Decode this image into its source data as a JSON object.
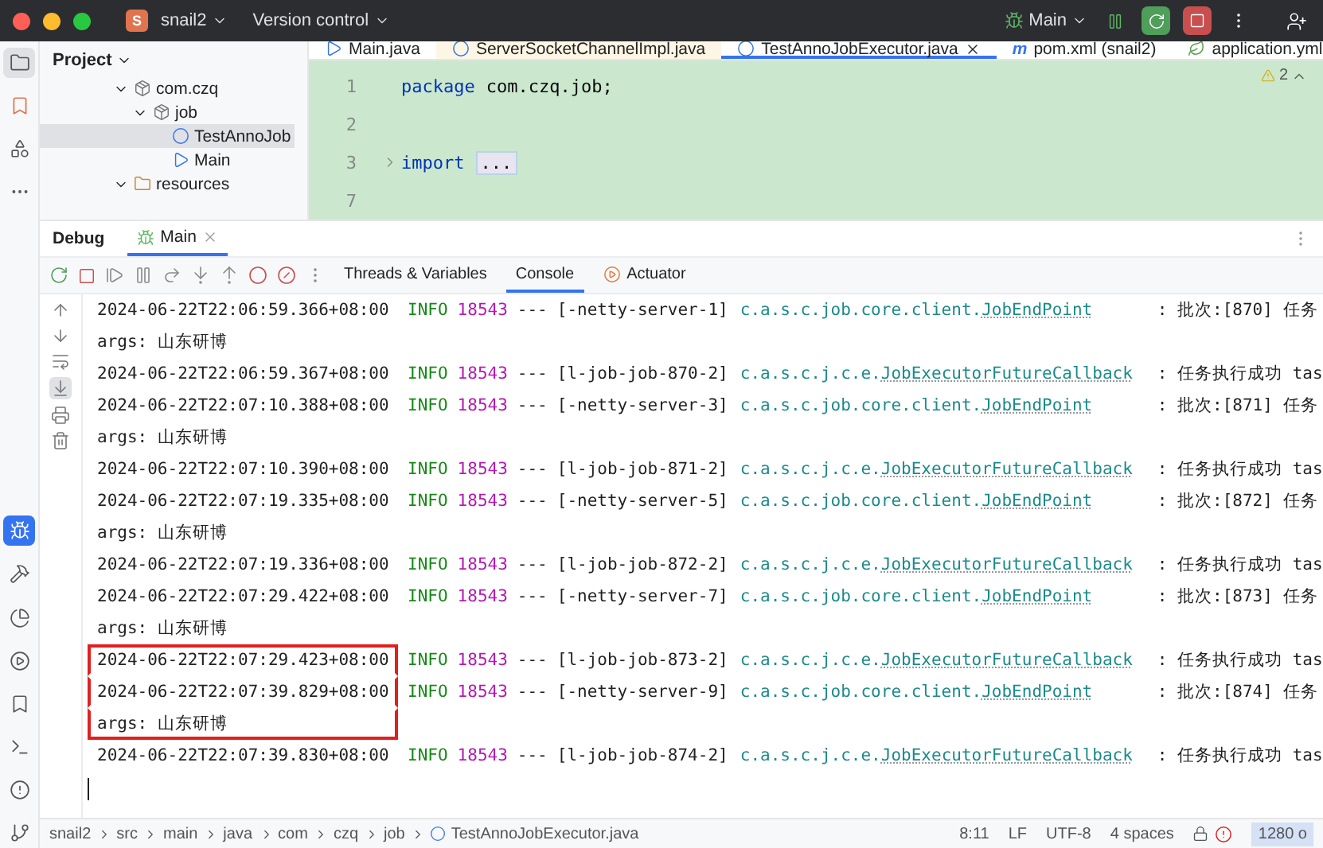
{
  "titlebar": {
    "project_badge": "S",
    "project": "snail2",
    "vcs": "Version control",
    "run_config": "Main"
  },
  "project_panel": {
    "title": "Project",
    "tree": [
      {
        "label": "com.czq",
        "kind": "package",
        "expanded": true,
        "selected": false,
        "children": [
          {
            "label": "job",
            "kind": "package",
            "expanded": true,
            "selected": false,
            "children": [
              {
                "label": "TestAnnoJob",
                "kind": "class",
                "selected": true
              },
              {
                "label": "Main",
                "kind": "main",
                "selected": false
              }
            ]
          }
        ]
      },
      {
        "label": "resources",
        "kind": "resources",
        "expanded": true,
        "selected": false
      }
    ]
  },
  "editor_tabs": [
    {
      "label": "Main.java",
      "kind": "main",
      "selected": false,
      "readonly": false
    },
    {
      "label": "ServerSocketChannelImpl.java",
      "kind": "class",
      "selected": false,
      "readonly": true
    },
    {
      "label": "TestAnnoJobExecutor.java",
      "kind": "class",
      "selected": true,
      "readonly": false
    },
    {
      "label": "pom.xml (snail2)",
      "kind": "maven",
      "icon": "m",
      "selected": false,
      "readonly": false
    },
    {
      "label": "application.yml",
      "kind": "yaml",
      "selected": false,
      "readonly": false
    }
  ],
  "editor": {
    "warnings": "2",
    "lines": [
      {
        "number": "1",
        "keyword": "package",
        "code": "com.czq.job;",
        "foldable": false
      },
      {
        "number": "2",
        "foldable": false
      },
      {
        "number": "3",
        "keyword": "import",
        "folded": "...",
        "foldable": true
      },
      {
        "number": "7",
        "foldable": false
      }
    ]
  },
  "debug_panel": {
    "title": "Debug",
    "session_tab": "Main",
    "tabs": [
      {
        "label": "Threads & Variables",
        "selected": false
      },
      {
        "label": "Console",
        "selected": true
      },
      {
        "label": "Actuator",
        "selected": false
      }
    ]
  },
  "console": [
    {
      "time": "2024-06-22T22:06:59.366+08:00",
      "level": "INFO",
      "pid": "18543",
      "sep": "---",
      "thread": "[-netty-server-1]",
      "logger": "c.a.s.c.job.core.client.",
      "logger_class": "JobEndPoint",
      "message": ": 批次:[870] 任务",
      "highlighted": false
    },
    {
      "text": "args: 山东研博",
      "highlighted": false
    },
    {
      "time": "2024-06-22T22:06:59.367+08:00",
      "level": "INFO",
      "pid": "18543",
      "sep": "---",
      "thread": "[l-job-job-870-2]",
      "logger": "c.a.s.c.j.c.e.",
      "logger_class": "JobExecutorFutureCallback",
      "message": ": 任务执行成功 tas",
      "highlighted": false
    },
    {
      "time": "2024-06-22T22:07:10.388+08:00",
      "level": "INFO",
      "pid": "18543",
      "sep": "---",
      "thread": "[-netty-server-3]",
      "logger": "c.a.s.c.job.core.client.",
      "logger_class": "JobEndPoint",
      "message": ": 批次:[871] 任务",
      "highlighted": false
    },
    {
      "text": "args: 山东研博",
      "highlighted": false
    },
    {
      "time": "2024-06-22T22:07:10.390+08:00",
      "level": "INFO",
      "pid": "18543",
      "sep": "---",
      "thread": "[l-job-job-871-2]",
      "logger": "c.a.s.c.j.c.e.",
      "logger_class": "JobExecutorFutureCallback",
      "message": ": 任务执行成功 tas",
      "highlighted": false
    },
    {
      "time": "2024-06-22T22:07:19.335+08:00",
      "level": "INFO",
      "pid": "18543",
      "sep": "---",
      "thread": "[-netty-server-5]",
      "logger": "c.a.s.c.job.core.client.",
      "logger_class": "JobEndPoint",
      "message": ": 批次:[872] 任务",
      "highlighted": false
    },
    {
      "text": "args: 山东研博",
      "highlighted": false
    },
    {
      "time": "2024-06-22T22:07:19.336+08:00",
      "level": "INFO",
      "pid": "18543",
      "sep": "---",
      "thread": "[l-job-job-872-2]",
      "logger": "c.a.s.c.j.c.e.",
      "logger_class": "JobExecutorFutureCallback",
      "message": ": 任务执行成功 tas",
      "highlighted": false
    },
    {
      "time": "2024-06-22T22:07:29.422+08:00",
      "level": "INFO",
      "pid": "18543",
      "sep": "---",
      "thread": "[-netty-server-7]",
      "logger": "c.a.s.c.job.core.client.",
      "logger_class": "JobEndPoint",
      "message": ": 批次:[873] 任务",
      "highlighted": false
    },
    {
      "text": "args: 山东研博",
      "highlighted": false
    },
    {
      "time": "2024-06-22T22:07:29.423+08:00",
      "level": "INFO",
      "pid": "18543",
      "sep": "---",
      "thread": "[l-job-job-873-2]",
      "logger": "c.a.s.c.j.c.e.",
      "logger_class": "JobExecutorFutureCallback",
      "message": ": 任务执行成功 tas",
      "highlighted": true
    },
    {
      "time": "2024-06-22T22:07:39.829+08:00",
      "level": "INFO",
      "pid": "18543",
      "sep": "---",
      "thread": "[-netty-server-9]",
      "logger": "c.a.s.c.job.core.client.",
      "logger_class": "JobEndPoint",
      "message": ": 批次:[874] 任务",
      "highlighted": true
    },
    {
      "text": "args: 山东研博",
      "highlighted": true
    },
    {
      "time": "2024-06-22T22:07:39.830+08:00",
      "level": "INFO",
      "pid": "18543",
      "sep": "---",
      "thread": "[l-job-job-874-2]",
      "logger": "c.a.s.c.j.c.e.",
      "logger_class": "JobExecutorFutureCallback",
      "message": ": 任务执行成功 tas",
      "highlighted": false
    }
  ],
  "breadcrumb": [
    "snail2",
    "src",
    "main",
    "java",
    "com",
    "czq",
    "job",
    "TestAnnoJobExecutor.java"
  ],
  "status": [
    "8:11",
    "LF",
    "UTF-8",
    "4 spaces"
  ],
  "memory": "1280 o"
}
